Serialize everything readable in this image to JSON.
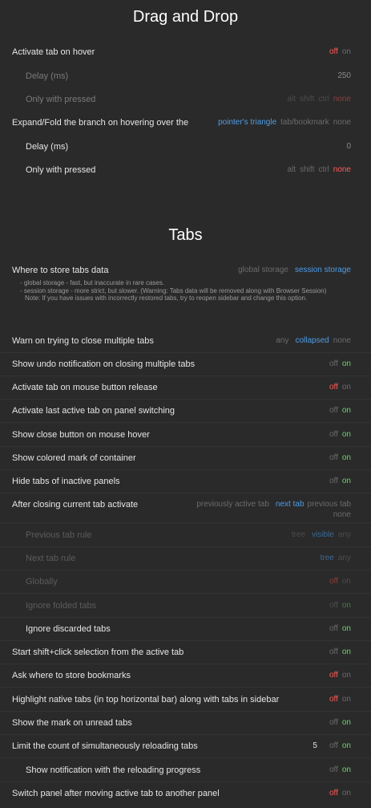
{
  "sections": {
    "dnd_title": "Drag and Drop",
    "tabs_title": "Tabs"
  },
  "dnd": {
    "activate_hover": {
      "label": "Activate tab on hover",
      "off": "off",
      "on": "on"
    },
    "hover_delay": {
      "label": "Delay (ms)",
      "value": "250"
    },
    "hover_pressed": {
      "label": "Only with pressed",
      "alt": "alt",
      "shift": "shift",
      "ctrl": "ctrl",
      "none": "none"
    },
    "expand_fold": {
      "label": "Expand/Fold the branch on hovering over the",
      "opt1": "pointer's triangle",
      "opt2": "tab/bookmark",
      "opt3": "none"
    },
    "fold_delay": {
      "label": "Delay (ms)",
      "value": "0"
    },
    "fold_pressed": {
      "label": "Only with pressed",
      "alt": "alt",
      "shift": "shift",
      "ctrl": "ctrl",
      "none": "none"
    }
  },
  "tabs": {
    "store": {
      "label": "Where to store tabs data",
      "opt1": "global storage",
      "opt2": "session storage",
      "note1": "- global storage - fast, but inaccurate in rare cases.",
      "note2": "- session storage - more strict, but slower. (Warning: Tabs data will be removed along with Browser Session)",
      "note3": "Note: If you have issues with incorrectly restored tabs, try to reopen sidebar and change this option."
    },
    "warn_close": {
      "label": "Warn on trying to close multiple tabs",
      "opt1": "any",
      "opt2": "collapsed",
      "opt3": "none"
    },
    "undo_notif": {
      "label": "Show undo notification on closing multiple tabs",
      "off": "off",
      "on": "on"
    },
    "activate_release": {
      "label": "Activate tab on mouse button release",
      "off": "off",
      "on": "on"
    },
    "activate_last": {
      "label": "Activate last active tab on panel switching",
      "off": "off",
      "on": "on"
    },
    "close_hover": {
      "label": "Show close button on mouse hover",
      "off": "off",
      "on": "on"
    },
    "colored_mark": {
      "label": "Show colored mark of container",
      "off": "off",
      "on": "on"
    },
    "hide_inactive": {
      "label": "Hide tabs of inactive panels",
      "off": "off",
      "on": "on"
    },
    "after_close": {
      "label": "After closing current tab activate",
      "opt1": "previously active tab",
      "opt2": "next tab",
      "opt3": "previous tab",
      "opt4": "none"
    },
    "prev_rule": {
      "label": "Previous tab rule",
      "opt1": "tree",
      "opt2": "visible",
      "opt3": "any"
    },
    "next_rule": {
      "label": "Next tab rule",
      "opt1": "tree",
      "opt2": "any"
    },
    "globally": {
      "label": "Globally",
      "off": "off",
      "on": "on"
    },
    "ignore_folded": {
      "label": "Ignore folded tabs",
      "off": "off",
      "on": "on"
    },
    "ignore_discarded": {
      "label": "Ignore discarded tabs",
      "off": "off",
      "on": "on"
    },
    "shift_click": {
      "label": "Start shift+click selection from the active tab",
      "off": "off",
      "on": "on"
    },
    "ask_bookmarks": {
      "label": "Ask where to store bookmarks",
      "off": "off",
      "on": "on"
    },
    "highlight_native": {
      "label": "Highlight native tabs (in top horizontal bar) along with tabs in sidebar",
      "off": "off",
      "on": "on"
    },
    "unread_mark": {
      "label": "Show the mark on unread tabs",
      "off": "off",
      "on": "on"
    },
    "limit_reload": {
      "label": "Limit the count of simultaneously reloading tabs",
      "value": "5",
      "off": "off",
      "on": "on"
    },
    "reload_notif": {
      "label": "Show notification with the reloading progress",
      "off": "off",
      "on": "on"
    },
    "switch_panel": {
      "label": "Switch panel after moving active tab to another panel",
      "off": "off",
      "on": "on"
    }
  }
}
